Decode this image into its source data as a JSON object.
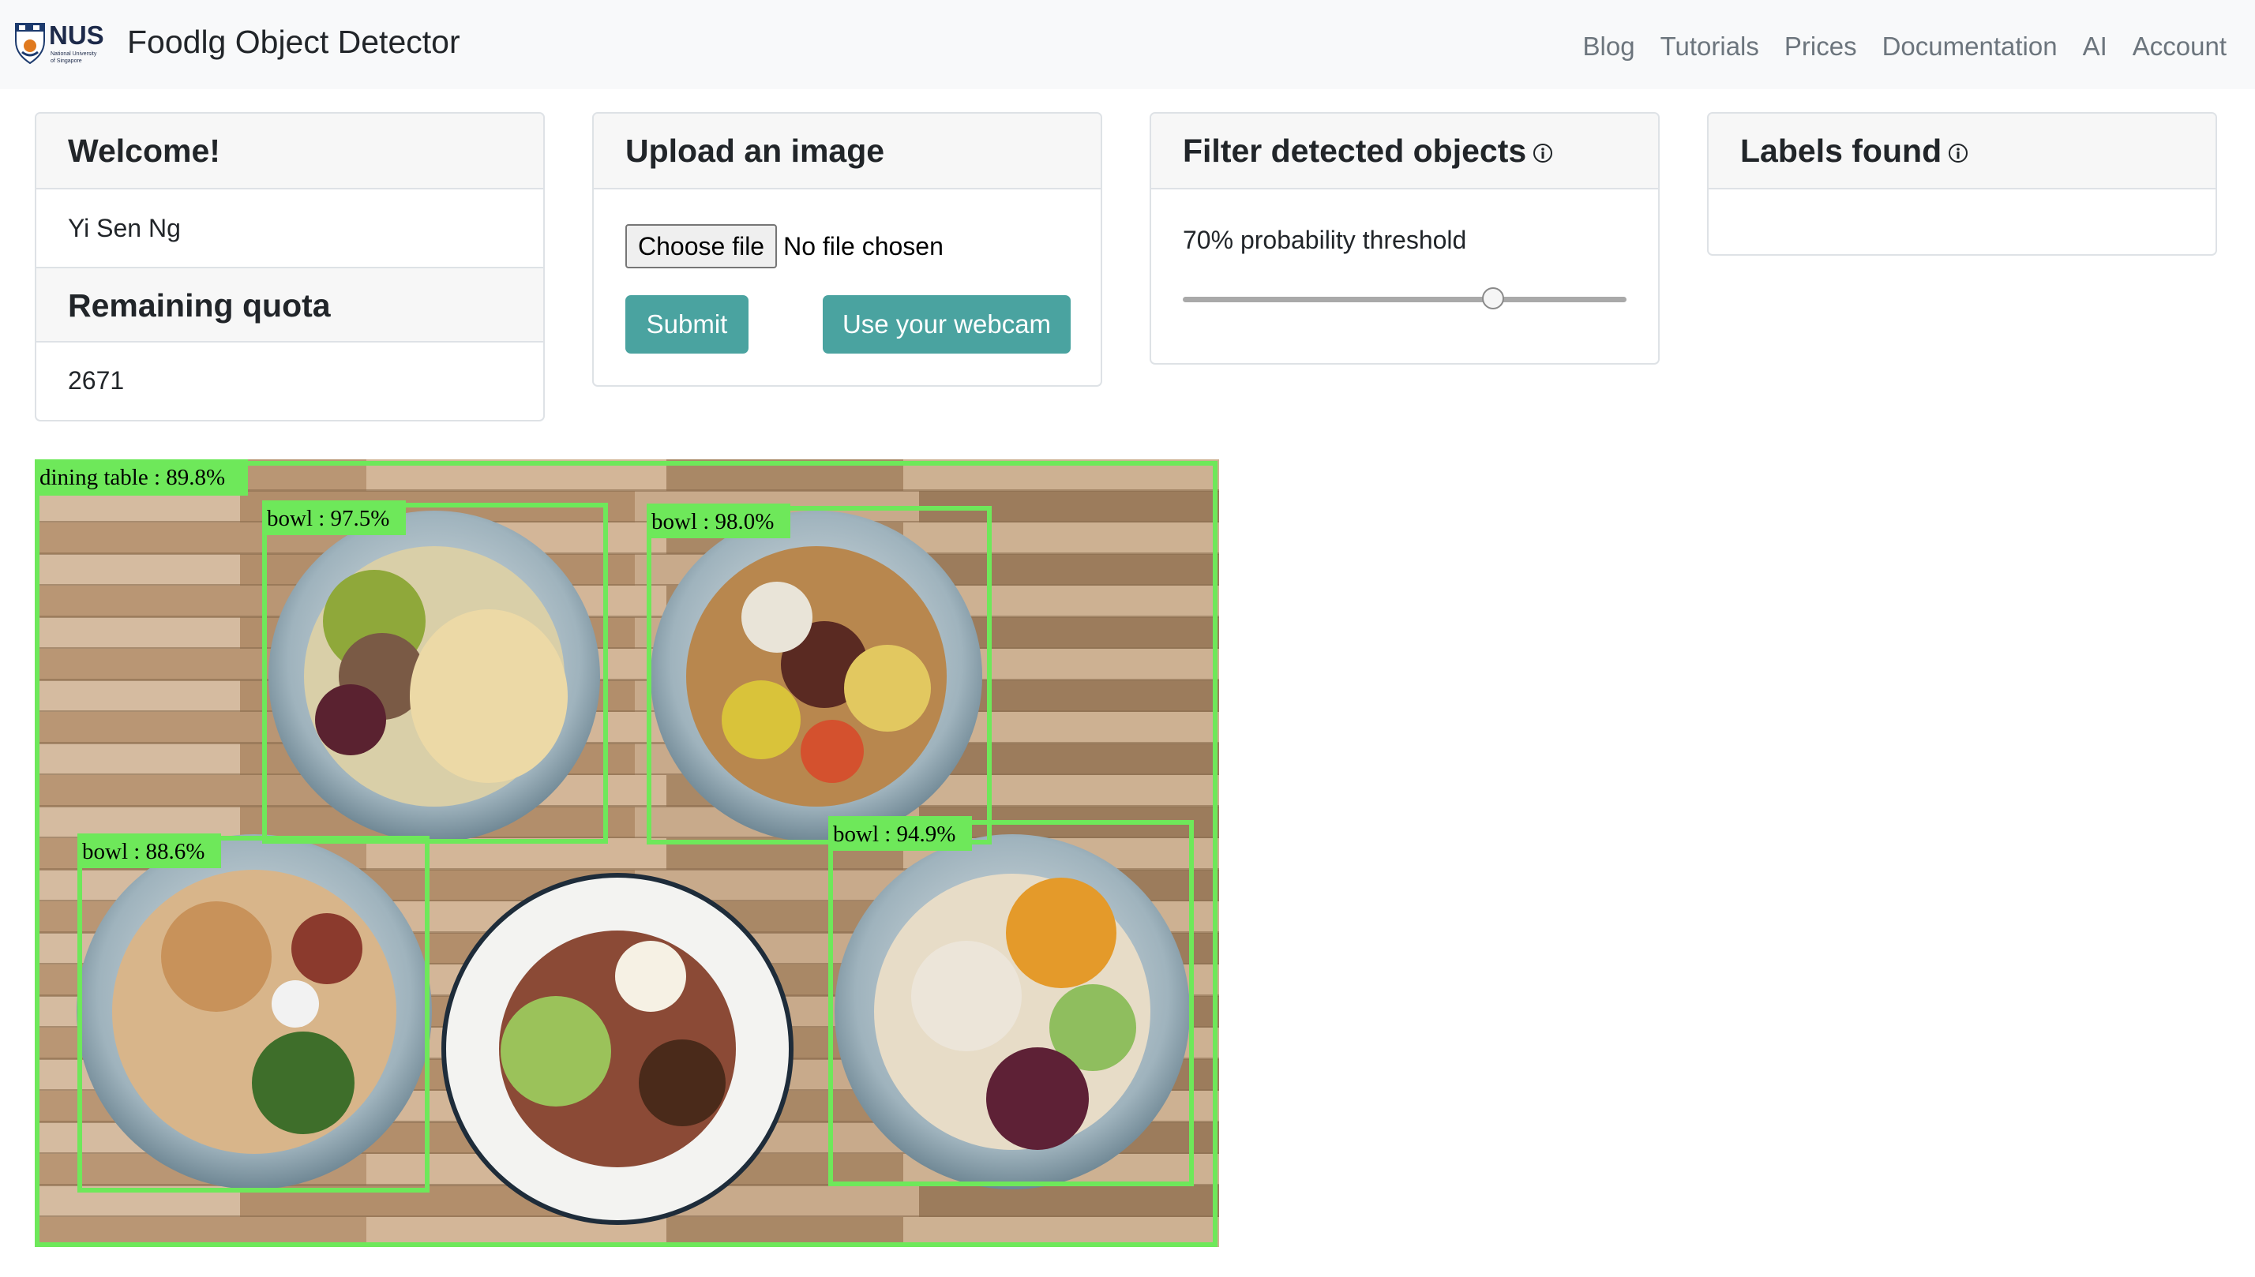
{
  "navbar": {
    "logo_text": "NUS",
    "logo_subtext": "National University of Singapore",
    "brand": "Foodlg Object Detector",
    "links": [
      "Blog",
      "Tutorials",
      "Prices",
      "Documentation",
      "AI",
      "Account"
    ]
  },
  "welcome_card": {
    "header": "Welcome!",
    "user_name": "Yi Sen Ng",
    "quota_header": "Remaining quota",
    "quota_value": "2671"
  },
  "upload_card": {
    "header": "Upload an image",
    "choose_file_label": "Choose file",
    "file_status": "No file chosen",
    "submit_label": "Submit",
    "webcam_label": "Use your webcam"
  },
  "filter_card": {
    "header": "Filter detected objects",
    "info_icon": "info-circle-icon",
    "threshold_label": "70% probability threshold",
    "threshold_value": 0.7
  },
  "labels_card": {
    "header": "Labels found",
    "info_icon": "info-circle-icon"
  },
  "detections": [
    {
      "label": "dining table : 89.8%"
    },
    {
      "label": "bowl : 97.5%"
    },
    {
      "label": "bowl : 98.0%"
    },
    {
      "label": "bowl : 88.6%"
    },
    {
      "label": "bowl : 94.9%"
    }
  ],
  "colors": {
    "navbar_bg": "#f8f9fa",
    "button_teal": "#4aa3a0",
    "bbox_green": "#6ee85a"
  }
}
